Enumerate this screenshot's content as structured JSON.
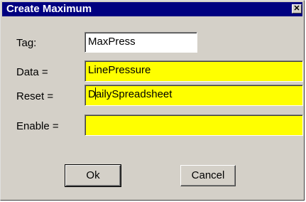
{
  "dialog": {
    "title": "Create Maximum",
    "close_glyph": "✕"
  },
  "form": {
    "tag_label": "Tag:",
    "tag_value": "MaxPress",
    "data_label": "Data =",
    "data_value": "LinePressure",
    "reset_label": "Reset =",
    "reset_value_before_caret": "D",
    "reset_value_after_caret": "ailySpreadsheet",
    "enable_label": "Enable =",
    "enable_value": ""
  },
  "buttons": {
    "ok_label": "Ok",
    "cancel_label": "Cancel"
  },
  "colors": {
    "titlebar": "#000080",
    "dialog_bg": "#d4d0c8",
    "expression_field": "#ffff00"
  }
}
